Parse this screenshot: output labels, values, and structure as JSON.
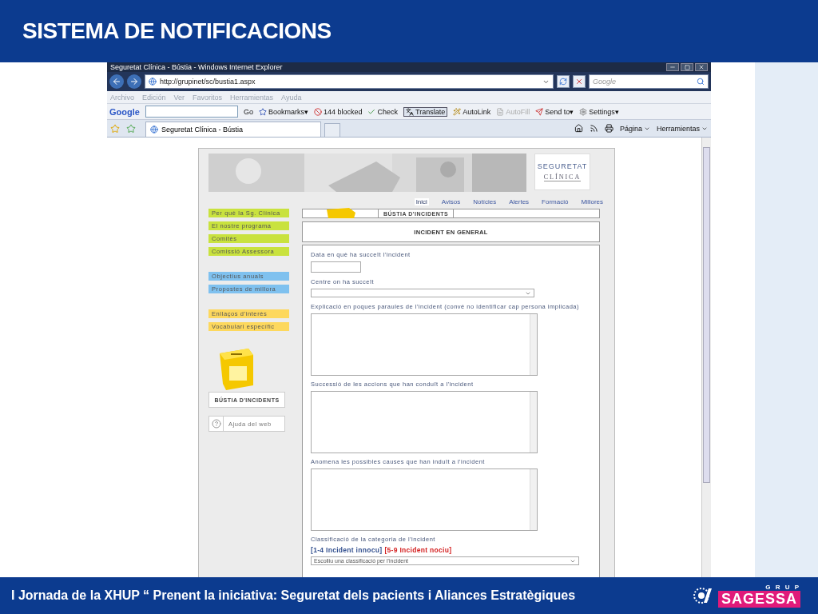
{
  "slide": {
    "title": "SISTEMA DE NOTIFICACIONS",
    "footer": "I Jornada de la XHUP “ Prenent la iniciativa: Seguretat dels pacients i Aliances Estratègiques",
    "logo": {
      "top": "G R U P",
      "name": "SAGESSA"
    }
  },
  "browser": {
    "title": "Seguretat Clínica - Bústia - Windows Internet Explorer",
    "address": "http://grupinet/sc/bustia1.aspx",
    "search_placeholder": "Google",
    "menu": [
      "Archivo",
      "Edición",
      "Ver",
      "Favoritos",
      "Herramientas",
      "Ayuda"
    ],
    "google_label": "Google",
    "toolbar": [
      {
        "label": "Go",
        "kind": "plain",
        "disabled": false
      },
      {
        "label": "Bookmarks▾",
        "kind": "star",
        "disabled": false
      },
      {
        "label": "144 blocked",
        "kind": "blocked",
        "disabled": false
      },
      {
        "label": "Check",
        "kind": "check",
        "disabled": false
      },
      {
        "label": "Translate",
        "kind": "translate",
        "disabled": false
      },
      {
        "label": "AutoLink",
        "kind": "wand",
        "disabled": false
      },
      {
        "label": "AutoFill",
        "kind": "fill",
        "disabled": true
      },
      {
        "label": "Send to▾",
        "kind": "send",
        "disabled": false
      },
      {
        "label": "Settings▾",
        "kind": "settings",
        "disabled": false
      }
    ],
    "tab": "Seguretat Clínica - Bústia",
    "commands": [
      "Página",
      "Herramientas"
    ]
  },
  "page": {
    "logo": [
      "SEGURETAT",
      "CLÍNICA"
    ],
    "nav": [
      {
        "label": "Inici",
        "selected": true
      },
      {
        "label": "Avisos",
        "selected": false
      },
      {
        "label": "Notícies",
        "selected": false
      },
      {
        "label": "Alertes",
        "selected": false
      },
      {
        "label": "Formació",
        "selected": false
      },
      {
        "label": "Millores",
        "selected": false
      }
    ],
    "sidebar": [
      [
        {
          "label": "Per què la Sg. Clínica",
          "color": "#c9e23e"
        },
        {
          "label": "El nostre programa",
          "color": "#c9e23e"
        },
        {
          "label": "Comitès",
          "color": "#c9e23e"
        },
        {
          "label": "Comissió Assessora",
          "color": "#c9e23e"
        }
      ],
      [
        {
          "label": "Objectius anuals",
          "color": "#7fc1ef"
        },
        {
          "label": "Propostes de millora",
          "color": "#7fc1ef"
        }
      ],
      [
        {
          "label": "Enllaços d'interès",
          "color": "#fdd85d"
        },
        {
          "label": "Vocabulari específic",
          "color": "#fdd85d"
        }
      ]
    ],
    "box_label": "BÚSTIA D'INCIDENTS",
    "help": "Ajuda del web",
    "banner": "BÚSTIA D'INCIDENTS",
    "heading": "INCIDENT EN GENERAL",
    "fields": [
      {
        "kind": "text",
        "label": "Data en què ha succeït l'incident"
      },
      {
        "kind": "select",
        "label": "Centre on ha succeït"
      },
      {
        "kind": "textarea",
        "label": "Explicació en poques paraules de l'incident (convé no identificar cap persona implicada)"
      },
      {
        "kind": "textarea",
        "label": "Successió de les accions que han conduït a l'incident"
      },
      {
        "kind": "textarea",
        "label": "Anomena les possibles causes que han induït a l'incident"
      },
      {
        "kind": "select",
        "label": "Classificació de la categoria de l'incident",
        "legend": [
          {
            "label": "[1-4 Incident innocu]",
            "color": "#33508f"
          },
          {
            "label": "[5-9 Incident nociu]",
            "color": "#d42020"
          }
        ],
        "placeholder": "Escolliu una classificació per l'incident"
      }
    ]
  }
}
